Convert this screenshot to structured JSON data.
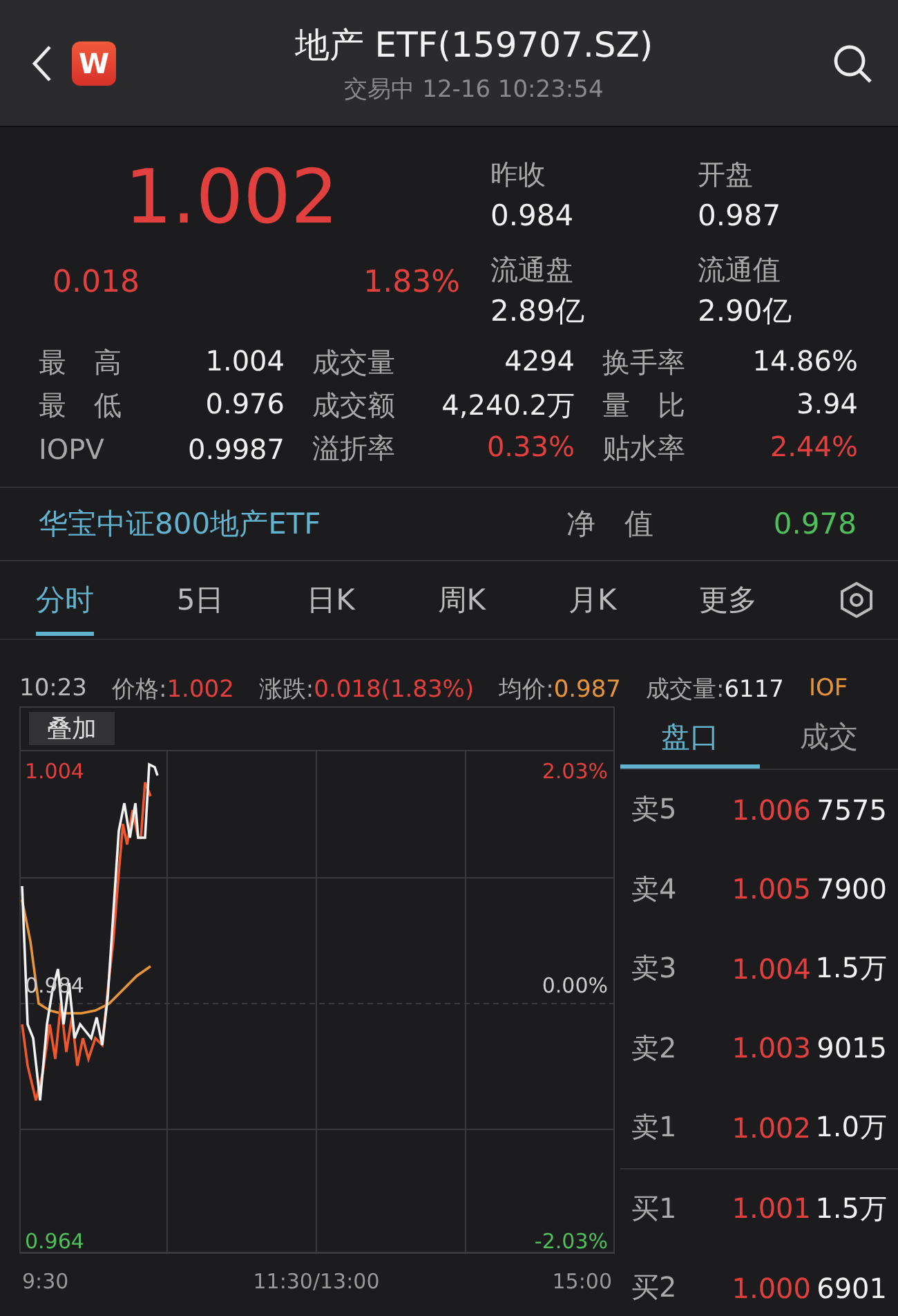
{
  "header": {
    "logo": "W",
    "title": "地产 ETF(159707.SZ)",
    "subtitle": "交易中 12-16 10:23:54"
  },
  "quote": {
    "price": "1.002",
    "change": "0.018",
    "percent": "1.83%",
    "color": "#e2403e",
    "facts": [
      {
        "label": "昨收",
        "value": "0.984"
      },
      {
        "label": "开盘",
        "value": "0.987"
      },
      {
        "label": "流通盘",
        "value": "2.89亿"
      },
      {
        "label": "流通值",
        "value": "2.90亿"
      }
    ]
  },
  "stats": [
    {
      "label": "最　高",
      "value": "1.004",
      "color": "#f0f0f0"
    },
    {
      "label": "成交量",
      "value": "4294",
      "color": "#f0f0f0"
    },
    {
      "label": "换手率",
      "value": "14.86%",
      "color": "#f0f0f0"
    },
    {
      "label": "最　低",
      "value": "0.976",
      "color": "#f0f0f0"
    },
    {
      "label": "成交额",
      "value": "4,240.2万",
      "color": "#f0f0f0"
    },
    {
      "label": "量　比",
      "value": "3.94",
      "color": "#f0f0f0"
    },
    {
      "label": "IOPV",
      "value": "0.9987",
      "color": "#f0f0f0"
    },
    {
      "label": "溢折率",
      "value": "0.33%",
      "color": "#e2403e"
    },
    {
      "label": "贴水率",
      "value": "2.44%",
      "color": "#e2403e"
    }
  ],
  "fund": {
    "name": "华宝中证800地产ETF",
    "label": "净　值",
    "value": "0.978",
    "color": "#4fbf5c"
  },
  "tabs": [
    {
      "label": "分时",
      "selected": true
    },
    {
      "label": "5日",
      "selected": false
    },
    {
      "label": "日K",
      "selected": false
    },
    {
      "label": "周K",
      "selected": false
    },
    {
      "label": "月K",
      "selected": false
    },
    {
      "label": "更多",
      "selected": false
    }
  ],
  "info": {
    "time": "10:23",
    "items": [
      {
        "label": "价格:",
        "value": "1.002",
        "color": "#e2403e"
      },
      {
        "label": "涨跌:",
        "value": "0.018(1.83%)",
        "color": "#e2403e"
      },
      {
        "label": "均价:",
        "value": "0.987",
        "color": "#e8953a"
      },
      {
        "label": "成交量:",
        "value": "6117",
        "color": "#f0f0f0"
      },
      {
        "label": "IOF",
        "color": "#e8953a"
      }
    ]
  },
  "chart": {
    "overlay_button": "叠加",
    "top_price": "1.004",
    "mid_price": "0.984",
    "bottom_price": "0.964",
    "top_pct": "2.03%",
    "mid_pct": "0.00%",
    "bottom_pct": "-2.03%",
    "times": [
      "9:30",
      "11:30/13:00",
      "15:00"
    ]
  },
  "book": {
    "tabs": [
      {
        "label": "盘口",
        "selected": true
      },
      {
        "label": "成交",
        "selected": false
      }
    ],
    "asks": [
      {
        "label": "卖5",
        "price": "1.006",
        "volume": "7575",
        "color": "#e2403e"
      },
      {
        "label": "卖4",
        "price": "1.005",
        "volume": "7900",
        "color": "#e2403e"
      },
      {
        "label": "卖3",
        "price": "1.004",
        "volume": "1.5万",
        "color": "#e2403e"
      },
      {
        "label": "卖2",
        "price": "1.003",
        "volume": "9015",
        "color": "#e2403e"
      },
      {
        "label": "卖1",
        "price": "1.002",
        "volume": "1.0万",
        "color": "#e2403e"
      }
    ],
    "bids": [
      {
        "label": "买1",
        "price": "1.001",
        "volume": "1.5万",
        "color": "#e2403e"
      },
      {
        "label": "买2",
        "price": "1.000",
        "volume": "6901",
        "color": "#e2403e"
      }
    ]
  }
}
